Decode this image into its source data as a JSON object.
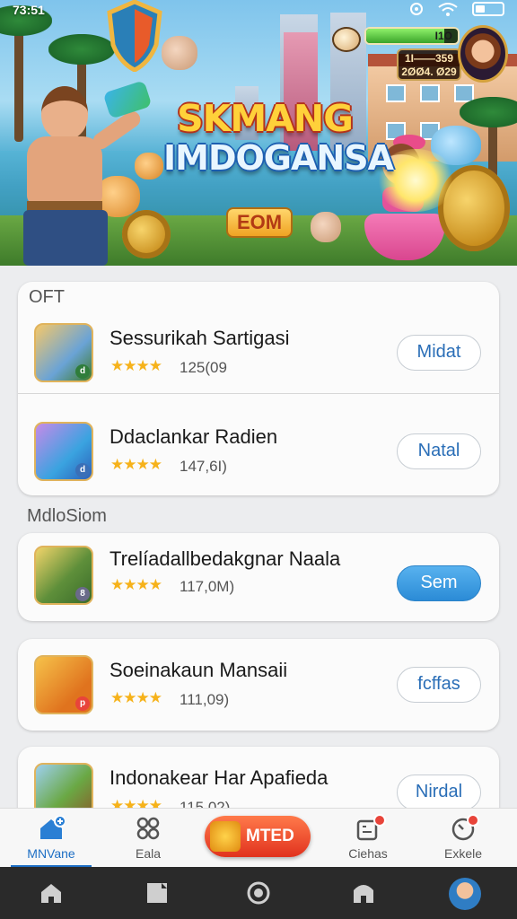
{
  "status": {
    "time": "73:51",
    "icons": [
      "location-icon",
      "wifi-icon",
      "battery-icon"
    ]
  },
  "hero": {
    "title_line1": "SKMANG",
    "title_line2": "IMDOGANSA",
    "badge_text": "EOM",
    "hud": {
      "level_text": "I1O",
      "score_line1": "1I——359",
      "score_line2": "2ØØ4. Ø29",
      "level_fill": 0.85
    }
  },
  "sections": [
    {
      "label": "OFT"
    },
    {
      "label": "MdloSiom"
    }
  ],
  "apps": [
    {
      "name": "Sessurikah Sartigasi",
      "stars": "★★★★",
      "rating": "125(09",
      "button": "Midat",
      "primary": false
    },
    {
      "name": "Ddaclankar Radien",
      "stars": "★★★★",
      "rating": "147,6I)",
      "button": "Natal",
      "primary": false
    },
    {
      "name": "Trelíadallbedakgnar Naala",
      "stars": "★★★★",
      "rating": "117,0M)",
      "button": "Sem",
      "primary": true
    },
    {
      "name": "Soeinakaun Mansaii",
      "stars": "★★★★",
      "rating": "111,09)",
      "button": "fcffas",
      "primary": false
    },
    {
      "name": "Indonakear Har Apafieda",
      "stars": "★★★★",
      "rating": "115,02)",
      "button": "Nirdal",
      "primary": false
    }
  ],
  "tabs": [
    {
      "label": "MNVane",
      "icon": "home-badge-icon",
      "active": true
    },
    {
      "label": "Eala",
      "icon": "grid-icon",
      "active": false
    },
    {
      "label": "MTED",
      "icon": "fire-badge-icon",
      "active": false
    },
    {
      "label": "Ciehas",
      "icon": "apps-notify-icon",
      "active": false
    },
    {
      "label": "Exkele",
      "icon": "compass-icon",
      "active": false
    }
  ],
  "system_nav": [
    "home-icon",
    "recent-icon",
    "circle-home-icon",
    "back-icon",
    "profile-avatar"
  ],
  "colors": {
    "accent": "#1d6ec4",
    "primary_button": "#2b8bd6",
    "star": "#f6b21a",
    "mted": "#e1321e"
  }
}
